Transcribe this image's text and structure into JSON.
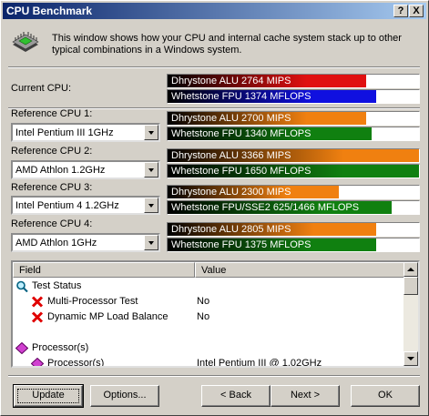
{
  "window": {
    "title": "CPU Benchmark",
    "help_button": "?",
    "close_button": "X"
  },
  "intro_text": "This window shows how your CPU and internal cache system stack up to other typical combinations in a Windows system.",
  "current_cpu": {
    "label": "Current CPU:",
    "alu_text": "Dhrystone ALU 2764 MIPS",
    "fpu_text": "Whetstone FPU 1374 MFLOPS",
    "alu_level": 0.79,
    "fpu_level": 0.83
  },
  "references": [
    {
      "label": "Reference CPU 1:",
      "selected": "Intel Pentium III 1GHz",
      "alu_text": "Dhrystone ALU 2700 MIPS",
      "fpu_text": "Whetstone FPU 1340 MFLOPS",
      "alu_level": 0.79,
      "fpu_level": 0.81
    },
    {
      "label": "Reference CPU 2:",
      "selected": "AMD Athlon 1.2GHz",
      "alu_text": "Dhrystone ALU 3366 MIPS",
      "fpu_text": "Whetstone FPU 1650 MFLOPS",
      "alu_level": 1.0,
      "fpu_level": 1.0
    },
    {
      "label": "Reference CPU 3:",
      "selected": "Intel Pentium 4 1.2GHz",
      "alu_text": "Dhrystone ALU 2300 MIPS",
      "fpu_text": "Whetstone FPU/SSE2 625/1466 MFLOPS",
      "alu_level": 0.68,
      "fpu_level": 0.89
    },
    {
      "label": "Reference CPU 4:",
      "selected": "AMD Athlon 1GHz",
      "alu_text": "Dhrystone ALU 2805 MIPS",
      "fpu_text": "Whetstone FPU 1375 MFLOPS",
      "alu_level": 0.83,
      "fpu_level": 0.83
    }
  ],
  "colors": {
    "current_alu": "#e01010",
    "current_fpu": "#1010e0",
    "ref_alu": "#f08010",
    "ref_fpu": "#108010"
  },
  "listview": {
    "col_field": "Field",
    "col_value": "Value",
    "rows": [
      {
        "text": "Test Status",
        "value": "",
        "icon": "magnifier-icon",
        "indent": 1
      },
      {
        "text": "Multi-Processor Test",
        "value": "No",
        "icon": "red-x-icon",
        "indent": 2
      },
      {
        "text": "Dynamic MP Load Balance",
        "value": "No",
        "icon": "red-x-icon",
        "indent": 2
      },
      {
        "text": "",
        "value": "",
        "icon": "",
        "indent": 0
      },
      {
        "text": "Processor(s)",
        "value": "",
        "icon": "diamond-icon",
        "indent": 1
      },
      {
        "text": "Processor(s)",
        "value": "Intel Pentium III @ 1.02GHz",
        "icon": "diamond-icon",
        "indent": 2
      }
    ]
  },
  "buttons": {
    "update": "Update",
    "options": "Options...",
    "back": "< Back",
    "next": "Next >",
    "ok": "OK"
  }
}
